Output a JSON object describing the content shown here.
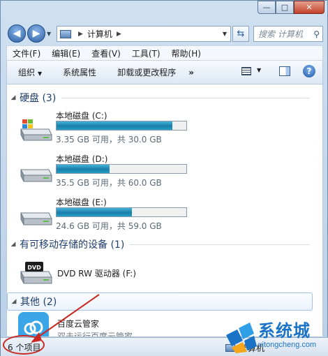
{
  "window": {
    "minimize_glyph": "—",
    "maximize_glyph": "□",
    "close_glyph": "✕"
  },
  "nav": {
    "back_glyph": "◀",
    "forward_glyph": "▶",
    "address_path": "计算机",
    "search_placeholder": "搜索 计算机"
  },
  "menu": {
    "items": [
      "文件(F)",
      "编辑(E)",
      "查看(V)",
      "工具(T)",
      "帮助(H)"
    ]
  },
  "toolbar": {
    "organize_label": "组织",
    "system_props_label": "系统属性",
    "uninstall_label": "卸载或更改程序",
    "more_label": "»",
    "help_glyph": "?"
  },
  "groups": {
    "hard_disks": "硬盘 (3)",
    "removable": "有可移动存储的设备 (1)",
    "other": "其他 (2)"
  },
  "drives": [
    {
      "name": "本地磁盘 (C:)",
      "info": "3.35 GB 可用，共 30.0 GB",
      "used_fraction": 0.89
    },
    {
      "name": "本地磁盘 (D:)",
      "info": "35.5 GB 可用，共 60.0 GB",
      "used_fraction": 0.41
    },
    {
      "name": "本地磁盘 (E:)",
      "info": "24.6 GB 可用，共 59.0 GB",
      "used_fraction": 0.58
    }
  ],
  "dvd": {
    "name": "DVD RW 驱动器 (F:)",
    "badge": "DVD"
  },
  "other_items": [
    {
      "name": "百度云管家",
      "desc": "双击运行百度云管家"
    }
  ],
  "status": {
    "item_count": "6 个项目",
    "location": "计算机"
  },
  "watermark": {
    "title": "系统城",
    "url": "xitongcheng.com"
  },
  "colors": {
    "annotation_red": "#c82820",
    "bar_fill": "#1a7ea9",
    "watermark_blue": "#1b73c7"
  }
}
